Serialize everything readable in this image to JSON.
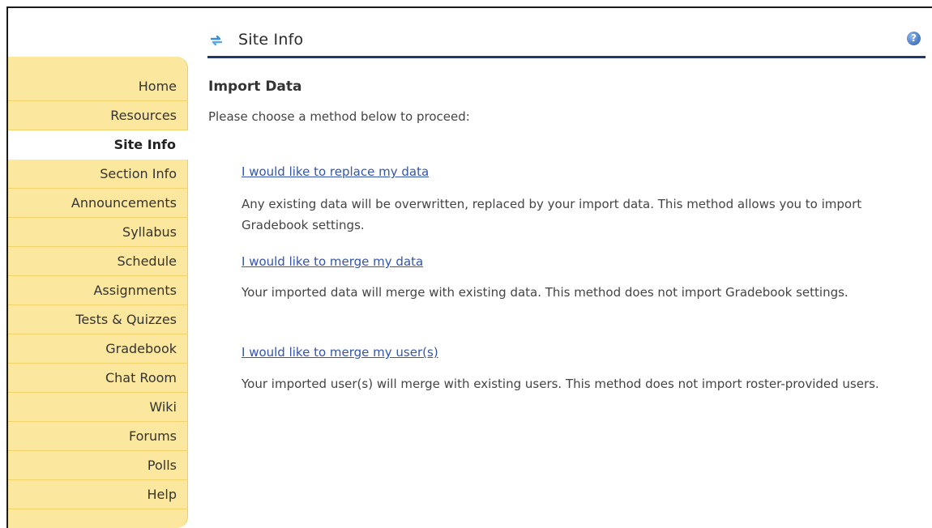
{
  "sidebar": {
    "items": [
      {
        "label": "Home",
        "active": false
      },
      {
        "label": "Resources",
        "active": false
      },
      {
        "label": "Site Info",
        "active": true
      },
      {
        "label": "Section Info",
        "active": false
      },
      {
        "label": "Announcements",
        "active": false
      },
      {
        "label": "Syllabus",
        "active": false
      },
      {
        "label": "Schedule",
        "active": false
      },
      {
        "label": "Assignments",
        "active": false
      },
      {
        "label": "Tests & Quizzes",
        "active": false
      },
      {
        "label": "Gradebook",
        "active": false
      },
      {
        "label": "Chat Room",
        "active": false
      },
      {
        "label": "Wiki",
        "active": false
      },
      {
        "label": "Forums",
        "active": false
      },
      {
        "label": "Polls",
        "active": false
      },
      {
        "label": "Help",
        "active": false
      }
    ]
  },
  "header": {
    "title": "Site Info",
    "reset_icon": "reset-icon",
    "help_icon": "help-icon",
    "help_glyph": "?"
  },
  "main": {
    "section_title": "Import Data",
    "instruction": "Please choose a method below to proceed:",
    "options": [
      {
        "link": "I would like to replace my data",
        "description": "Any existing data will be overwritten, replaced by your import data. This method allows you to import Gradebook settings."
      },
      {
        "link": "I would like to merge my data",
        "description": "Your imported data will merge with existing data. This method does not import Gradebook settings."
      },
      {
        "link": "I would like to merge my user(s)",
        "description": "Your imported user(s) will merge with existing users. This method does not import roster-provided users."
      }
    ]
  },
  "colors": {
    "sidebar_bg": "#fbe79e",
    "header_rule": "#1e3a6b",
    "link": "#3355aa"
  }
}
